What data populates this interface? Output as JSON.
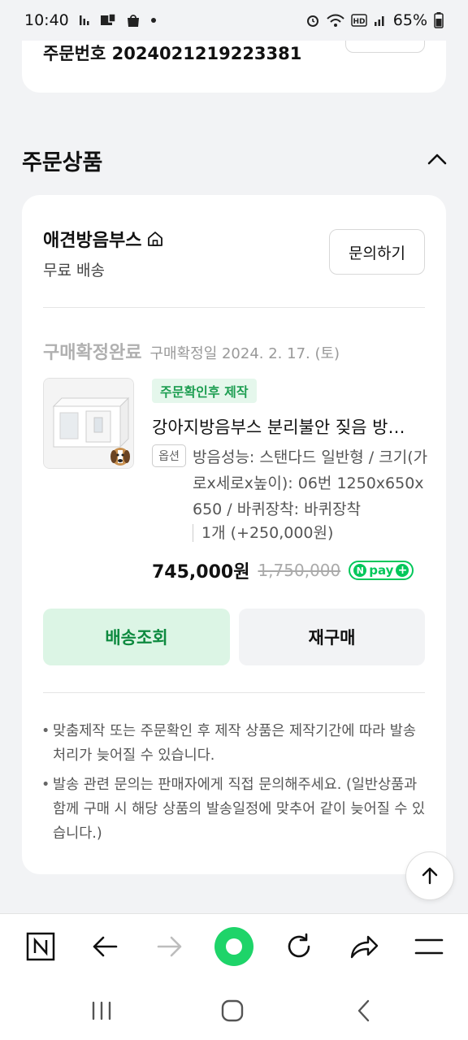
{
  "status_bar": {
    "time": "10:40",
    "notif_icons": [
      "bars-icon",
      "mail-icon",
      "bag-icon",
      "dot-icon"
    ],
    "battery": "65%",
    "right_icons": [
      "alarm-icon",
      "wifi-icon",
      "hd-icon",
      "signal-icon",
      "battery-icon"
    ]
  },
  "top_card": {
    "order_number": "주문번호 2024021219223381"
  },
  "section": {
    "title": "주문상품"
  },
  "order_card": {
    "seller": "애견방음부스",
    "shipping": "무료 배송",
    "ask_button": "문의하기",
    "status": "구매확정완료",
    "confirm_date": "구매확정일 2024. 2. 17. (토)",
    "badge": "주문확인후 제작",
    "product_name": "강아지방음부스 분리불안 짖음 방지 방음부스",
    "option_tag": "옵션",
    "option_text": "방음성능: 스탠다드 일반형 / 크기(가로x세로x높이): 06번 1250x650x650 / 바퀴장착: 바퀴장착",
    "quantity": "1개 (+250,000원)",
    "price": "745,000원",
    "original_price": "1,750,000",
    "npay_label": "pay",
    "track_button": "배송조회",
    "rebuy_button": "재구매",
    "notes": [
      "맞춤제작 또는 주문확인 후 제작 상품은 제작기간에 따라 발송 처리가 늦어질 수 있습니다.",
      "발송 관련 문의는 판매자에게 직접 문의해주세요. (일반상품과 함께 구매 시 해당 상품의 발송일정에 맞추어 같이 늦어질 수 있습니다.)"
    ]
  },
  "colors": {
    "accent_green": "#03c75a",
    "track_bg": "#dcf5e5",
    "badge_bg": "#e5f7ec"
  }
}
